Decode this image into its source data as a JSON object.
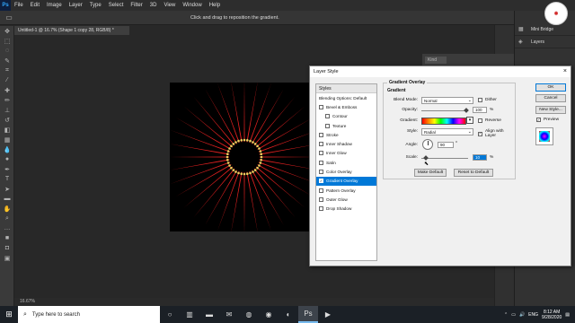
{
  "app": {
    "logo": "Ps"
  },
  "menu": [
    "File",
    "Edit",
    "Image",
    "Layer",
    "Type",
    "Select",
    "Filter",
    "3D",
    "View",
    "Window",
    "Help"
  ],
  "options_bar": {
    "hint": "Click and drag to reposition the gradient."
  },
  "document": {
    "tab_title": "Untitled-1 @ 16.7% (Shape 1 copy 28, RGB/8) *",
    "zoom": "16.67%"
  },
  "right_panel": {
    "items": [
      {
        "label": "Mini Bridge",
        "icon": "bridge-icon"
      },
      {
        "label": "Layers",
        "icon": "layers-icon"
      }
    ],
    "kind": "Kind"
  },
  "dialog": {
    "title": "Layer Style",
    "close": "×",
    "styles_header": "Styles",
    "styles": [
      {
        "label": "Blending Options: Default",
        "checkbox": false,
        "has_cb": false,
        "sub": false,
        "selected": false
      },
      {
        "label": "Bevel & Emboss",
        "checkbox": false,
        "has_cb": true,
        "sub": false,
        "selected": false
      },
      {
        "label": "Contour",
        "checkbox": false,
        "has_cb": true,
        "sub": true,
        "selected": false
      },
      {
        "label": "Texture",
        "checkbox": false,
        "has_cb": true,
        "sub": true,
        "selected": false
      },
      {
        "label": "Stroke",
        "checkbox": false,
        "has_cb": true,
        "sub": false,
        "selected": false
      },
      {
        "label": "Inner Shadow",
        "checkbox": false,
        "has_cb": true,
        "sub": false,
        "selected": false
      },
      {
        "label": "Inner Glow",
        "checkbox": false,
        "has_cb": true,
        "sub": false,
        "selected": false
      },
      {
        "label": "Satin",
        "checkbox": false,
        "has_cb": true,
        "sub": false,
        "selected": false
      },
      {
        "label": "Color Overlay",
        "checkbox": false,
        "has_cb": true,
        "sub": false,
        "selected": false
      },
      {
        "label": "Gradient Overlay",
        "checkbox": true,
        "has_cb": true,
        "sub": false,
        "selected": true
      },
      {
        "label": "Pattern Overlay",
        "checkbox": false,
        "has_cb": true,
        "sub": false,
        "selected": false
      },
      {
        "label": "Outer Glow",
        "checkbox": false,
        "has_cb": true,
        "sub": false,
        "selected": false
      },
      {
        "label": "Drop Shadow",
        "checkbox": false,
        "has_cb": true,
        "sub": false,
        "selected": false
      }
    ],
    "gradient_overlay": {
      "group_title": "Gradient Overlay",
      "sub_title": "Gradient",
      "blend_mode_label": "Blend Mode:",
      "blend_mode_value": "Normal",
      "dither_label": "Dither",
      "opacity_label": "Opacity:",
      "opacity_value": "100",
      "opacity_level": 1.0,
      "gradient_label": "Gradient:",
      "reverse_label": "Reverse",
      "style_label": "Style:",
      "style_value": "Radial",
      "align_label": "Align with Layer",
      "angle_label": "Angle:",
      "angle_value": "90",
      "angle_unit": "°",
      "scale_label": "Scale:",
      "scale_value": "10",
      "scale_level": 0.07,
      "percent": "%",
      "make_default": "Make Default",
      "reset_default": "Reset to Default"
    },
    "buttons": {
      "ok": "OK",
      "cancel": "Cancel",
      "new_style": "New Style...",
      "preview": "Preview"
    }
  },
  "taskbar": {
    "search_placeholder": "Type here to search",
    "lang": "ENG",
    "time": "8:12 AM",
    "date": "9/28/2020"
  },
  "artwork": {
    "burst_color": "#e02020",
    "center_color": "#000000",
    "dot_color": "#f0d060",
    "spikes": 36
  }
}
